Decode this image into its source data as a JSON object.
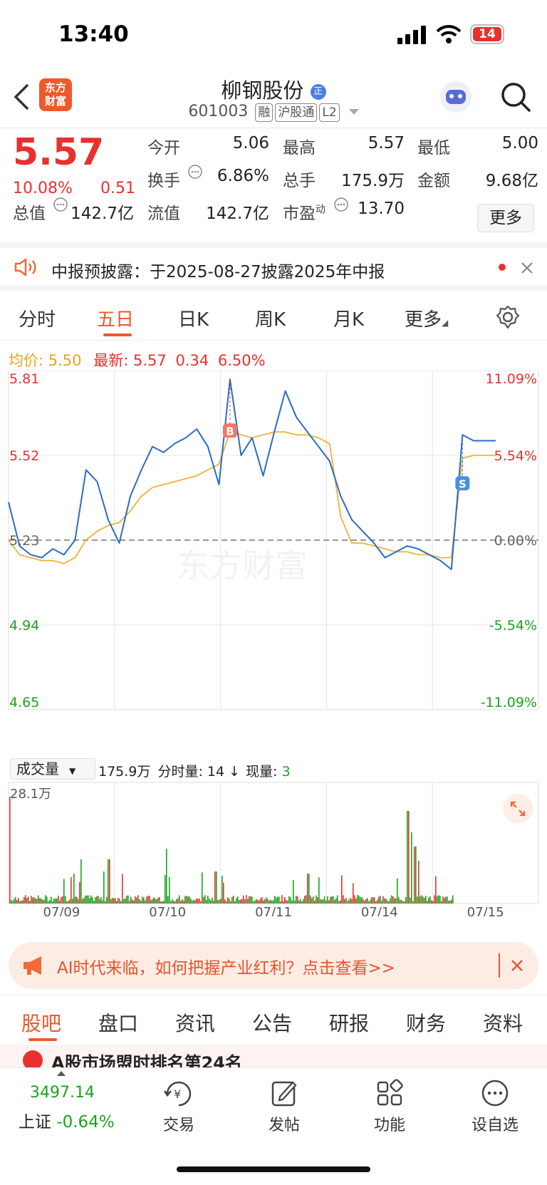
{
  "status_bar": {
    "time": "13:40",
    "battery": "14"
  },
  "header": {
    "logo_line1": "东方",
    "logo_line2": "财富",
    "title": "柳钢股份",
    "cert_badge": "正",
    "code": "601003",
    "tags": [
      "融",
      "沪股通",
      "L2"
    ]
  },
  "quote": {
    "price": "5.57",
    "change_pct": "10.08%",
    "change": "0.51",
    "open_label": "今开",
    "open": "5.06",
    "high_label": "最高",
    "high": "5.57",
    "low_label": "最低",
    "low": "5.00",
    "turnover_label": "换手",
    "turnover": "6.86%",
    "volume_label": "总手",
    "volume": "175.9万",
    "amount_label": "金额",
    "amount": "9.68亿",
    "mcap_label": "总值",
    "mcap": "142.7亿",
    "float_label": "流值",
    "float": "142.7亿",
    "pe_label": "市盈",
    "pe_sup": "动",
    "pe": "13.70",
    "more_btn": "更多"
  },
  "notice": {
    "text": "中报预披露：于2025-08-27披露2025年中报"
  },
  "tabs": [
    "分时",
    "五日",
    "日K",
    "周K",
    "月K",
    "更多"
  ],
  "active_tab": 1,
  "info": {
    "avg_label": "均价:",
    "avg": "5.50",
    "latest_label": "最新:",
    "latest": "5.57",
    "chg": "0.34",
    "pct": "6.50%"
  },
  "chart_data": {
    "type": "line",
    "left_ticks": [
      "5.81",
      "5.52",
      "5.23",
      "4.94",
      "4.65"
    ],
    "right_ticks": [
      "11.09%",
      "5.54%",
      "0.00%",
      "-5.54%",
      "-11.09%"
    ],
    "ylim": [
      4.65,
      5.81
    ],
    "x_labels": [
      "07/09",
      "07/10",
      "07/11",
      "07/14",
      "07/15"
    ],
    "watermark": "东方财富",
    "markers": [
      "B",
      "S"
    ],
    "series": [
      {
        "name": "价格",
        "color": "#2b6cc4",
        "values": [
          5.36,
          5.21,
          5.18,
          5.17,
          5.2,
          5.18,
          5.23,
          5.47,
          5.43,
          5.3,
          5.22,
          5.38,
          5.47,
          5.55,
          5.53,
          5.56,
          5.58,
          5.61,
          5.55,
          5.42,
          5.78,
          5.52,
          5.58,
          5.45,
          5.6,
          5.74,
          5.65,
          5.6,
          5.55,
          5.5,
          5.38,
          5.3,
          5.26,
          5.22,
          5.17,
          5.19,
          5.21,
          5.2,
          5.18,
          5.16,
          5.13,
          5.59,
          5.57,
          5.57,
          5.57
        ]
      },
      {
        "name": "均价",
        "color": "#f2b233",
        "values": [
          5.23,
          5.18,
          5.17,
          5.16,
          5.16,
          5.15,
          5.17,
          5.23,
          5.26,
          5.28,
          5.29,
          5.33,
          5.38,
          5.41,
          5.42,
          5.43,
          5.44,
          5.45,
          5.47,
          5.49,
          5.6,
          5.59,
          5.58,
          5.59,
          5.6,
          5.6,
          5.59,
          5.59,
          5.58,
          5.56,
          5.31,
          5.22,
          5.22,
          5.21,
          5.2,
          5.19,
          5.19,
          5.18,
          5.18,
          5.17,
          5.17,
          5.51,
          5.52,
          5.52,
          5.52
        ]
      }
    ]
  },
  "volume": {
    "label": "成交量",
    "total": "175.9万",
    "tick_label": "分时量:",
    "tick": "14",
    "arrow": "↓",
    "cur_label": "现量:",
    "cur": "3",
    "max": "28.1万"
  },
  "ad": {
    "text": "AI时代来临，如何把握产业红利？点击查看>>"
  },
  "feature_tabs": [
    "股吧",
    "盘口",
    "资讯",
    "公告",
    "研报",
    "财务",
    "资料"
  ],
  "peek": {
    "text": "A股市场盟时排名第24名"
  },
  "bottom": {
    "index_value": "3497.14",
    "index_name": "上证",
    "index_pct": "-0.64%",
    "nav": [
      "交易",
      "发帖",
      "功能",
      "设自选"
    ]
  }
}
